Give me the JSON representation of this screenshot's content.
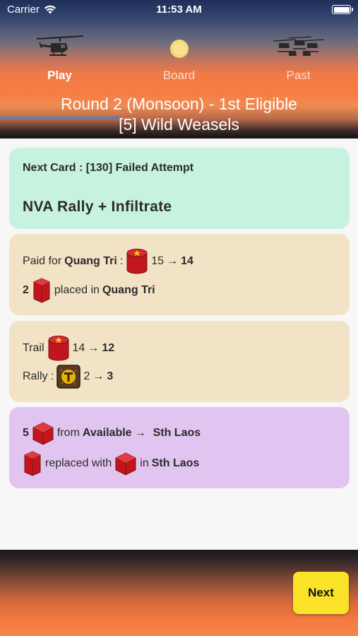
{
  "status_bar": {
    "carrier": "Carrier",
    "time": "11:53 AM"
  },
  "tabs": [
    {
      "label": "Play",
      "icon": "helicopter-icon",
      "active": true
    },
    {
      "label": "Board",
      "icon": "sun-icon",
      "active": false
    },
    {
      "label": "Past",
      "icon": "helicopter-squadron-icon",
      "active": false
    }
  ],
  "title": {
    "line1": "Round 2 (Monsoon) - 1st Eligible",
    "line2": "[5] Wild Weasels"
  },
  "next_card": {
    "label": "Next Card : [130] Failed Attempt",
    "action": "NVA  Rally  +  Infiltrate"
  },
  "paid": {
    "prefix": "Paid for",
    "location": "Quang Tri",
    "colon": ":",
    "icon": "nva-base-star-icon",
    "from": "15",
    "arrow": "→",
    "to": "14",
    "count": "2",
    "piece_icon": "nva-guerrilla-icon",
    "placed_text": "placed in",
    "placed_location": "Quang Tri"
  },
  "trail": {
    "label": "Trail",
    "icon": "nva-base-star-icon",
    "from": "14",
    "arrow": "→",
    "to": "12",
    "rally_label": "Rally :",
    "rally_icon": "trail-t-icon",
    "rally_from": "2",
    "rally_arrow": "→",
    "rally_to": "3"
  },
  "laos": {
    "count": "5",
    "cube_icon": "nva-troop-cube-icon",
    "from_text": "from",
    "source": "Available",
    "arrow": "→",
    "destination": "Sth Laos",
    "piece_icon": "nva-guerrilla-icon",
    "replaced_text": "replaced with",
    "replacement_icon": "nva-troop-cube-icon",
    "in_text": "in",
    "in_location": "Sth Laos"
  },
  "footer": {
    "next_label": "Next"
  },
  "colors": {
    "next_card_bg": "#c7f2e0",
    "action_card_bg": "#f3e3c6",
    "laos_card_bg": "#e1c5f0",
    "next_button": "#f9e227",
    "nva_red": "#d0242b"
  }
}
